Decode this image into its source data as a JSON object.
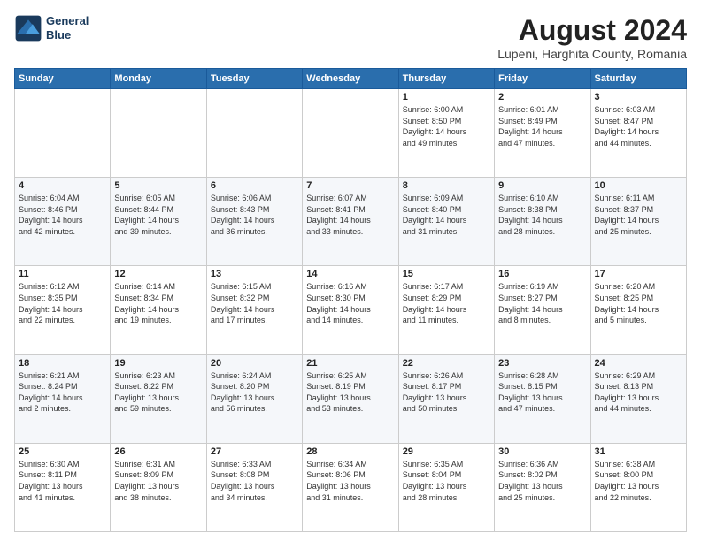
{
  "header": {
    "logo_line1": "General",
    "logo_line2": "Blue",
    "main_title": "August 2024",
    "subtitle": "Lupeni, Harghita County, Romania"
  },
  "weekdays": [
    "Sunday",
    "Monday",
    "Tuesday",
    "Wednesday",
    "Thursday",
    "Friday",
    "Saturday"
  ],
  "weeks": [
    [
      {
        "day": "",
        "info": ""
      },
      {
        "day": "",
        "info": ""
      },
      {
        "day": "",
        "info": ""
      },
      {
        "day": "",
        "info": ""
      },
      {
        "day": "1",
        "info": "Sunrise: 6:00 AM\nSunset: 8:50 PM\nDaylight: 14 hours\nand 49 minutes."
      },
      {
        "day": "2",
        "info": "Sunrise: 6:01 AM\nSunset: 8:49 PM\nDaylight: 14 hours\nand 47 minutes."
      },
      {
        "day": "3",
        "info": "Sunrise: 6:03 AM\nSunset: 8:47 PM\nDaylight: 14 hours\nand 44 minutes."
      }
    ],
    [
      {
        "day": "4",
        "info": "Sunrise: 6:04 AM\nSunset: 8:46 PM\nDaylight: 14 hours\nand 42 minutes."
      },
      {
        "day": "5",
        "info": "Sunrise: 6:05 AM\nSunset: 8:44 PM\nDaylight: 14 hours\nand 39 minutes."
      },
      {
        "day": "6",
        "info": "Sunrise: 6:06 AM\nSunset: 8:43 PM\nDaylight: 14 hours\nand 36 minutes."
      },
      {
        "day": "7",
        "info": "Sunrise: 6:07 AM\nSunset: 8:41 PM\nDaylight: 14 hours\nand 33 minutes."
      },
      {
        "day": "8",
        "info": "Sunrise: 6:09 AM\nSunset: 8:40 PM\nDaylight: 14 hours\nand 31 minutes."
      },
      {
        "day": "9",
        "info": "Sunrise: 6:10 AM\nSunset: 8:38 PM\nDaylight: 14 hours\nand 28 minutes."
      },
      {
        "day": "10",
        "info": "Sunrise: 6:11 AM\nSunset: 8:37 PM\nDaylight: 14 hours\nand 25 minutes."
      }
    ],
    [
      {
        "day": "11",
        "info": "Sunrise: 6:12 AM\nSunset: 8:35 PM\nDaylight: 14 hours\nand 22 minutes."
      },
      {
        "day": "12",
        "info": "Sunrise: 6:14 AM\nSunset: 8:34 PM\nDaylight: 14 hours\nand 19 minutes."
      },
      {
        "day": "13",
        "info": "Sunrise: 6:15 AM\nSunset: 8:32 PM\nDaylight: 14 hours\nand 17 minutes."
      },
      {
        "day": "14",
        "info": "Sunrise: 6:16 AM\nSunset: 8:30 PM\nDaylight: 14 hours\nand 14 minutes."
      },
      {
        "day": "15",
        "info": "Sunrise: 6:17 AM\nSunset: 8:29 PM\nDaylight: 14 hours\nand 11 minutes."
      },
      {
        "day": "16",
        "info": "Sunrise: 6:19 AM\nSunset: 8:27 PM\nDaylight: 14 hours\nand 8 minutes."
      },
      {
        "day": "17",
        "info": "Sunrise: 6:20 AM\nSunset: 8:25 PM\nDaylight: 14 hours\nand 5 minutes."
      }
    ],
    [
      {
        "day": "18",
        "info": "Sunrise: 6:21 AM\nSunset: 8:24 PM\nDaylight: 14 hours\nand 2 minutes."
      },
      {
        "day": "19",
        "info": "Sunrise: 6:23 AM\nSunset: 8:22 PM\nDaylight: 13 hours\nand 59 minutes."
      },
      {
        "day": "20",
        "info": "Sunrise: 6:24 AM\nSunset: 8:20 PM\nDaylight: 13 hours\nand 56 minutes."
      },
      {
        "day": "21",
        "info": "Sunrise: 6:25 AM\nSunset: 8:19 PM\nDaylight: 13 hours\nand 53 minutes."
      },
      {
        "day": "22",
        "info": "Sunrise: 6:26 AM\nSunset: 8:17 PM\nDaylight: 13 hours\nand 50 minutes."
      },
      {
        "day": "23",
        "info": "Sunrise: 6:28 AM\nSunset: 8:15 PM\nDaylight: 13 hours\nand 47 minutes."
      },
      {
        "day": "24",
        "info": "Sunrise: 6:29 AM\nSunset: 8:13 PM\nDaylight: 13 hours\nand 44 minutes."
      }
    ],
    [
      {
        "day": "25",
        "info": "Sunrise: 6:30 AM\nSunset: 8:11 PM\nDaylight: 13 hours\nand 41 minutes."
      },
      {
        "day": "26",
        "info": "Sunrise: 6:31 AM\nSunset: 8:09 PM\nDaylight: 13 hours\nand 38 minutes."
      },
      {
        "day": "27",
        "info": "Sunrise: 6:33 AM\nSunset: 8:08 PM\nDaylight: 13 hours\nand 34 minutes."
      },
      {
        "day": "28",
        "info": "Sunrise: 6:34 AM\nSunset: 8:06 PM\nDaylight: 13 hours\nand 31 minutes."
      },
      {
        "day": "29",
        "info": "Sunrise: 6:35 AM\nSunset: 8:04 PM\nDaylight: 13 hours\nand 28 minutes."
      },
      {
        "day": "30",
        "info": "Sunrise: 6:36 AM\nSunset: 8:02 PM\nDaylight: 13 hours\nand 25 minutes."
      },
      {
        "day": "31",
        "info": "Sunrise: 6:38 AM\nSunset: 8:00 PM\nDaylight: 13 hours\nand 22 minutes."
      }
    ]
  ]
}
